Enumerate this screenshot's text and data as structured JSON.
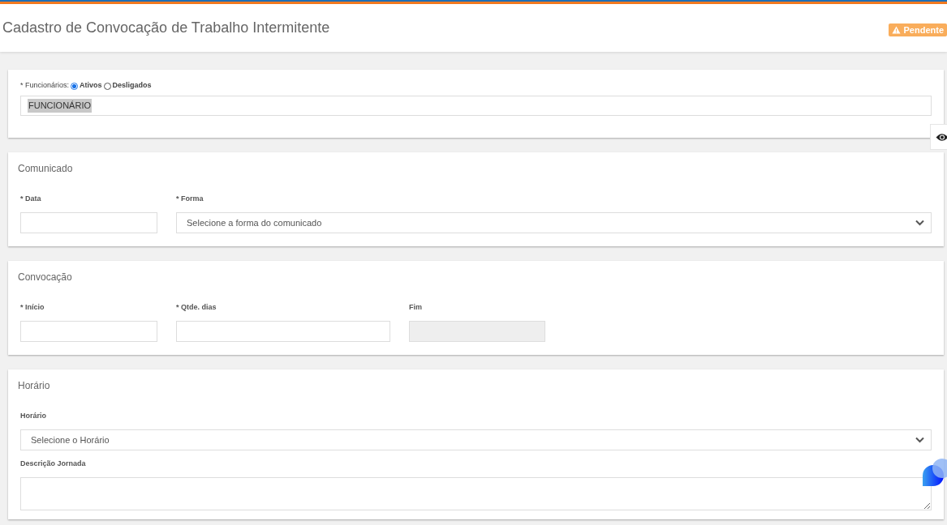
{
  "header": {
    "title": "Cadastro de Convocação de Trabalho Intermitente",
    "status_badge": "Pendente"
  },
  "employees": {
    "label": "* Funcionários:",
    "options": [
      {
        "label": "Ativos",
        "selected": true
      },
      {
        "label": "Desligados",
        "selected": false
      }
    ],
    "value": "FUNCIONÁRIO"
  },
  "sections": [
    {
      "title": "Comunicado",
      "fields": [
        {
          "kind": "text",
          "label": "* Data",
          "disabled": false
        },
        {
          "kind": "select",
          "label": "* Forma",
          "value": "Selecione a forma do comunicado",
          "disabled": false
        }
      ]
    },
    {
      "title": "Convocação",
      "fields": [
        {
          "kind": "text",
          "label": "* Início",
          "disabled": false
        },
        {
          "kind": "text",
          "label": "* Qtde. dias",
          "disabled": false
        },
        {
          "kind": "text",
          "label": "Fim",
          "disabled": true
        }
      ]
    },
    {
      "title": "Horário",
      "fields": [
        {
          "kind": "select",
          "label": "Horário",
          "value": "Selecione o Horário",
          "disabled": false
        },
        {
          "kind": "textarea",
          "label": "Descrição Jornada",
          "disabled": false
        }
      ]
    }
  ]
}
